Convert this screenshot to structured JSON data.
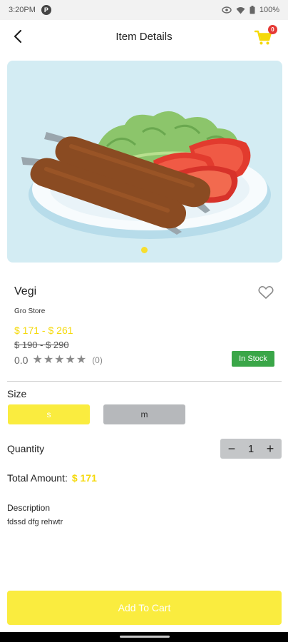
{
  "status_bar": {
    "time": "3:20PM",
    "notification_letter": "P",
    "battery": "100%"
  },
  "app_bar": {
    "title": "Item Details",
    "cart_count": "0"
  },
  "product": {
    "name": "Vegi",
    "store": "Gro Store",
    "price_range": "$ 171 - $ 261",
    "old_price_range": "$ 190 - $ 290",
    "rating": "0.0",
    "review_count": "(0)",
    "stock_status": "In Stock"
  },
  "size": {
    "label": "Size",
    "options": [
      "s",
      "m"
    ],
    "selected": "s"
  },
  "quantity": {
    "label": "Quantity",
    "value": "1",
    "decrement": "−",
    "increment": "+"
  },
  "total": {
    "label": "Total Amount:",
    "value": "$ 171"
  },
  "description": {
    "label": "Description",
    "text": "fdssd  dfg rehwtr"
  },
  "add_to_cart": {
    "label": "Add To Cart"
  },
  "colors": {
    "accent": "#faec3f",
    "price": "#f5d90a",
    "in_stock": "#3aa648",
    "badge": "#e53935"
  },
  "icons": [
    "back-arrow-icon",
    "cart-icon",
    "heart-outline-icon",
    "star-icon"
  ]
}
